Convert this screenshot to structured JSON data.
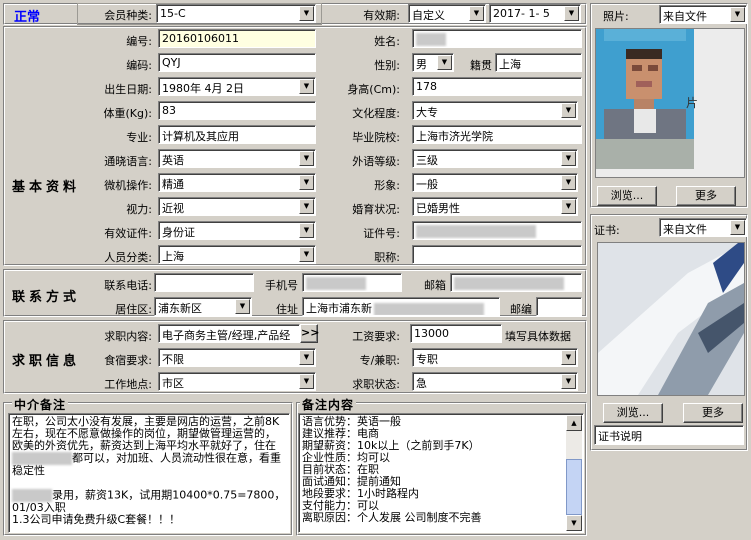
{
  "status": "正常",
  "colors": {
    "status": "#0000ff",
    "accent": "#000080"
  },
  "member_type": {
    "label": "会员种类:",
    "value": "15-C"
  },
  "validity": {
    "label": "有效期:",
    "mode": "自定义",
    "date": "2017- 1- 5"
  },
  "photo": {
    "label": "照片:",
    "source": "来自文件",
    "browse": "浏览...",
    "more": "更多"
  },
  "certificate": {
    "label": "证书:",
    "source": "来自文件",
    "browse": "浏览...",
    "more": "更多",
    "desc": "证书说明"
  },
  "sections": {
    "basic": "基本资料",
    "contact": "联系方式",
    "job": "求职信息"
  },
  "basic": {
    "number": {
      "label": "编号:",
      "value": "20160106011"
    },
    "name": {
      "label": "姓名:",
      "value": ""
    },
    "code": {
      "label": "编码:",
      "value": "QYJ"
    },
    "gender": {
      "label": "性别:",
      "value": "男"
    },
    "native": {
      "label": "籍贯",
      "value": "上海"
    },
    "birthday": {
      "label": "出生日期:",
      "value": "1980年 4月 2日"
    },
    "height": {
      "label": "身高(Cm):",
      "value": "178"
    },
    "weight": {
      "label": "体重(Kg):",
      "value": "83"
    },
    "education": {
      "label": "文化程度:",
      "value": "大专"
    },
    "major": {
      "label": "专业:",
      "value": "计算机及其应用"
    },
    "school": {
      "label": "毕业院校:",
      "value": "上海市济光学院"
    },
    "language": {
      "label": "通晓语言:",
      "value": "英语"
    },
    "foreign_level": {
      "label": "外语等级:",
      "value": "三级"
    },
    "computer": {
      "label": "微机操作:",
      "value": "精通"
    },
    "appearance": {
      "label": "形象:",
      "value": "一般"
    },
    "vision": {
      "label": "视力:",
      "value": "近视"
    },
    "marital": {
      "label": "婚育状况:",
      "value": "已婚男性"
    },
    "id_type": {
      "label": "有效证件:",
      "value": "身份证"
    },
    "id_number": {
      "label": "证件号:",
      "value": ""
    },
    "category": {
      "label": "人员分类:",
      "value": "上海"
    },
    "title": {
      "label": "职称:",
      "value": ""
    }
  },
  "contact": {
    "phone": {
      "label": "联系电话:",
      "value": ""
    },
    "mobile": {
      "label": "手机号",
      "value": ""
    },
    "email": {
      "label": "邮箱",
      "value": ""
    },
    "district": {
      "label": "居住区:",
      "value": "浦东新区"
    },
    "address": {
      "label": "住址",
      "value": "上海市浦东新"
    },
    "postcode": {
      "label": "邮编",
      "value": ""
    }
  },
  "job": {
    "content": {
      "label": "求职内容:",
      "value": "电子商务主管/经理,产品经",
      "expand": ">>"
    },
    "salary": {
      "label": "工资要求:",
      "value": "13000",
      "hint": "填写具体数据"
    },
    "lodging": {
      "label": "食宿要求:",
      "value": "不限"
    },
    "type": {
      "label": "专/兼职:",
      "value": "专职"
    },
    "location": {
      "label": "工作地点:",
      "value": "市区"
    },
    "status": {
      "label": "求职状态:",
      "value": "急"
    }
  },
  "agent_notes": {
    "title": "中介备注",
    "lines": [
      "在职，公司太小没有发展，主要是网店的运营，之前8K左右，现在不愿意做操作的岗位，期望做管理运营的，欧美的外资优先，薪资达到上海平均水平就好了，住在",
      "都可以，对加班、人员流动性很在意，看重稳定性",
      "",
      "录用，薪资13K，试用期10400*0.75=7800，01/03入职",
      "1.3公司申请免费升级C套餐！！！"
    ]
  },
  "remarks": {
    "title": "备注内容",
    "lines": [
      "语言优势：英语一般",
      "建议推荐：电商",
      "期望薪资：10k以上（之前到手7K）",
      "企业性质：均可以",
      "目前状态：在职",
      "面试通知：提前通知",
      "地段要求：1小时路程内",
      "支付能力：可以",
      "离职原因：个人发展 公司制度不完善"
    ]
  }
}
